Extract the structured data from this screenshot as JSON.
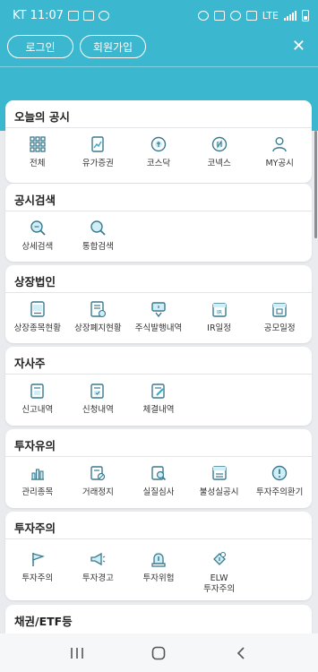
{
  "status_bar": {
    "carrier_time": "KT 11:07",
    "network": "LTE",
    "battery_percent": 40
  },
  "header": {
    "login_label": "로그인",
    "signup_label": "회원가입",
    "close_glyph": "✕"
  },
  "sections": [
    {
      "title": "오늘의 공시",
      "items": [
        {
          "label": "전체",
          "icon": "grid-icon"
        },
        {
          "label": "유가증권",
          "icon": "securities-icon"
        },
        {
          "label": "코스닥",
          "icon": "kosdaq-icon"
        },
        {
          "label": "코넥스",
          "icon": "konex-icon"
        },
        {
          "label": "MY공시",
          "icon": "user-icon"
        }
      ]
    },
    {
      "title": "공시검색",
      "items": [
        {
          "label": "상세검색",
          "icon": "search-detail-icon"
        },
        {
          "label": "통합검색",
          "icon": "search-icon"
        }
      ]
    },
    {
      "title": "상장법인",
      "items": [
        {
          "label": "상장종목현황",
          "icon": "listed-document-icon"
        },
        {
          "label": "상장폐지현황",
          "icon": "delisted-document-icon"
        },
        {
          "label": "주식발행내역",
          "icon": "issuance-icon"
        },
        {
          "label": "IR일정",
          "icon": "ir-calendar-icon"
        },
        {
          "label": "공모일정",
          "icon": "offering-calendar-icon"
        }
      ]
    },
    {
      "title": "자사주",
      "items": [
        {
          "label": "신고내역",
          "icon": "report-icon"
        },
        {
          "label": "신청내역",
          "icon": "application-icon"
        },
        {
          "label": "체결내역",
          "icon": "contract-icon"
        }
      ]
    },
    {
      "title": "투자유의",
      "items": [
        {
          "label": "관리종목",
          "icon": "chart-icon"
        },
        {
          "label": "거래정지",
          "icon": "trading-halt-icon"
        },
        {
          "label": "실질심사",
          "icon": "review-icon"
        },
        {
          "label": "불성실공시",
          "icon": "unfaithful-disclosure-icon"
        },
        {
          "label": "투자주의환기",
          "icon": "alert-icon"
        }
      ]
    },
    {
      "title": "투자주의",
      "items": [
        {
          "label": "투자주의",
          "icon": "flag-icon"
        },
        {
          "label": "투자경고",
          "icon": "megaphone-icon"
        },
        {
          "label": "투자위험",
          "icon": "siren-icon"
        },
        {
          "label": "ELW\n투자주의",
          "icon": "elw-icon"
        }
      ]
    },
    {
      "title": "채권/ETF등",
      "items": []
    }
  ],
  "colors": {
    "header": "#3bb7cf",
    "accent": "#3aa6c1",
    "background": "#e9ebee"
  },
  "navbar": {
    "recent": "recent-apps-icon",
    "home": "home-icon",
    "back": "back-icon"
  }
}
